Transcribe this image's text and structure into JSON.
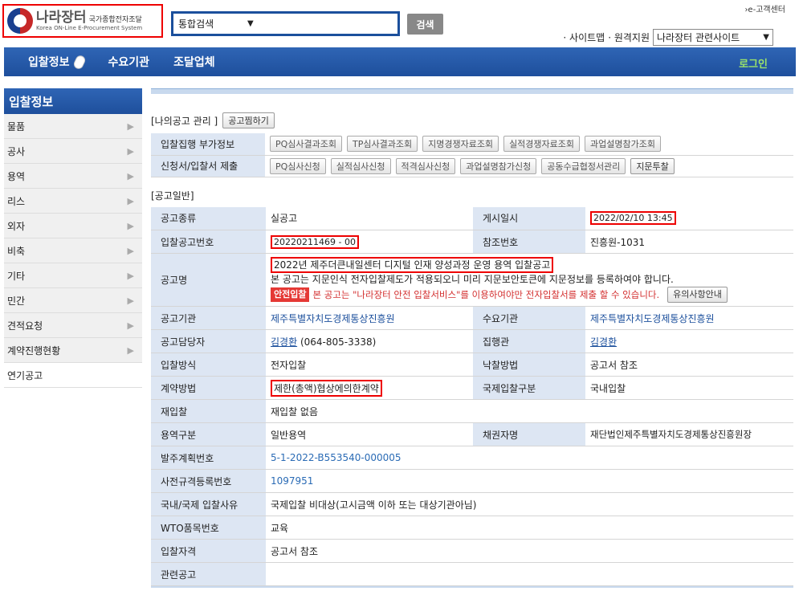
{
  "header": {
    "logo_main": "나라장터",
    "logo_small": "국가종합전자조달",
    "logo_sub": "Korea ON-Line E-Procurement System",
    "search_select": "통합검색",
    "search_button": "검색",
    "customer_center": "›e-고객센터",
    "links": [
      "· 사이트맵",
      "· 원격지원"
    ],
    "site_select": "나라장터 관련사이트"
  },
  "nav": {
    "items": [
      "입찰정보",
      "수요기관",
      "조달업체"
    ],
    "login": "로그인"
  },
  "sidebar": {
    "title": "입찰정보",
    "items": [
      "물품",
      "공사",
      "용역",
      "리스",
      "외자",
      "비축",
      "기타",
      "민간",
      "견적요청",
      "계약진행현황",
      "연기공고"
    ]
  },
  "my_notice": {
    "label": "[나의공고 관리 ]",
    "button": "공고찜하기"
  },
  "panel": {
    "rows": [
      {
        "label": "입찰집행 부가정보",
        "buttons": [
          "PQ심사결과조회",
          "TP심사결과조회",
          "지명경쟁자료조회",
          "실적경쟁자료조회",
          "과업설명참가조회"
        ]
      },
      {
        "label": "신청서/입찰서 제출",
        "buttons": [
          "PQ심사신청",
          "실적심사신청",
          "적격심사신청",
          "과업설명참가신청",
          "공동수급협정서관리",
          "지문투찰"
        ]
      }
    ]
  },
  "general": {
    "title": "[공고일반]",
    "notice_type_label": "공고종류",
    "notice_type": "실공고",
    "post_date_label": "게시일시",
    "post_date": "2022/02/10 13:45",
    "notice_no_label": "입찰공고번호",
    "notice_no": "20220211469 - 00",
    "ref_no_label": "참조번호",
    "ref_no": "진흥원-1031",
    "name_label": "공고명",
    "name": "2022년 제주더큰내일센터 디지털 인재 양성과정 운영 용역 입찰공고",
    "name_note": "본 공고는 지문인식 전자입찰제도가 적용되오니 미리 지문보안토큰에 지문정보를 등록하여야 합니다.",
    "safe_badge": "안전입찰",
    "safe_note": "본 공고는 \"나라장터 안전 입찰서비스\"를 이용하여야만 전자입찰서를 제출 할 수 있습니다.",
    "safe_button": "유의사항안내",
    "agency_label": "공고기관",
    "agency": "제주특별자치도경제통상진흥원",
    "demand_label": "수요기관",
    "demand": "제주특별자치도경제통상진흥원",
    "officer_label": "공고담당자",
    "officer_name": "김경환",
    "officer_phone": " (064-805-3338)",
    "executor_label": "집행관",
    "executor": "김경환",
    "bid_method_label": "입찰방식",
    "bid_method": "전자입찰",
    "award_method_label": "낙찰방법",
    "award_method": "공고서 참조",
    "contract_method_label": "계약방법",
    "contract_method": "제한(총액)협상에의한계약",
    "intl_label": "국제입찰구분",
    "intl": "국내입찰",
    "rebid_label": "재입찰",
    "rebid": "재입찰 없음",
    "service_label": "용역구분",
    "service": "일반용역",
    "creditor_label": "채권자명",
    "creditor": "재단법인제주특별자치도경제통상진흥원장",
    "order_plan_label": "발주계획번호",
    "order_plan": "5-1-2022-B553540-000005",
    "prespec_label": "사전규격등록번호",
    "prespec": "1097951",
    "reason_label": "국내/국제 입찰사유",
    "reason": "국제입찰 비대상(고시금액 이하 또는 대상기관아님)",
    "wto_label": "WTO품목번호",
    "wto": "교육",
    "qual_label": "입찰자격",
    "qual": "공고서 참조",
    "related_label": "관련공고",
    "related": ""
  }
}
